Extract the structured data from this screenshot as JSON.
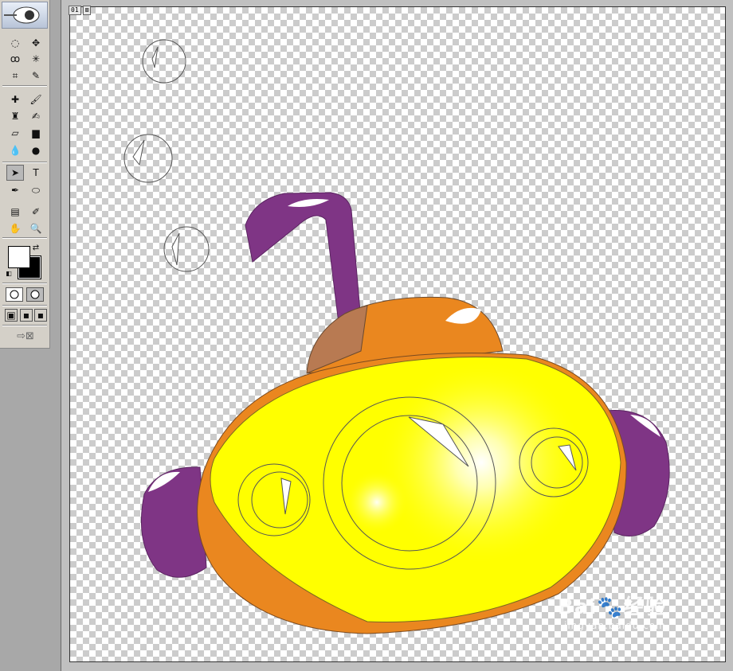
{
  "canvas": {
    "tabs": [
      "01",
      "⊠"
    ],
    "checker_colors": [
      "#ffffff",
      "#cccccc"
    ]
  },
  "toolbox": {
    "tools": [
      {
        "name": "marquee-tool",
        "glyph": "◌"
      },
      {
        "name": "move-tool",
        "glyph": "✥"
      },
      {
        "name": "lasso-tool",
        "glyph": "ꝏ"
      },
      {
        "name": "magic-wand-tool",
        "glyph": "✳"
      },
      {
        "name": "crop-tool",
        "glyph": "⌗"
      },
      {
        "name": "slice-tool",
        "glyph": "✎"
      },
      {
        "name": "healing-brush-tool",
        "glyph": "✚"
      },
      {
        "name": "brush-tool",
        "glyph": "🖌"
      },
      {
        "name": "clone-stamp-tool",
        "glyph": "♜"
      },
      {
        "name": "history-brush-tool",
        "glyph": "✍"
      },
      {
        "name": "eraser-tool",
        "glyph": "▱"
      },
      {
        "name": "gradient-tool",
        "glyph": "▆"
      },
      {
        "name": "blur-tool",
        "glyph": "💧"
      },
      {
        "name": "dodge-tool",
        "glyph": "●"
      },
      {
        "name": "path-selection-tool",
        "glyph": "➤"
      },
      {
        "name": "type-tool",
        "glyph": "T"
      },
      {
        "name": "pen-tool",
        "glyph": "✒"
      },
      {
        "name": "shape-tool",
        "glyph": "⬭"
      },
      {
        "name": "notes-tool",
        "glyph": "▤"
      },
      {
        "name": "eyedropper-tool",
        "glyph": "✐"
      },
      {
        "name": "hand-tool",
        "glyph": "✋"
      },
      {
        "name": "zoom-tool",
        "glyph": "🔍"
      }
    ],
    "foreground_color": "#ffffff",
    "background_color": "#000000"
  },
  "artwork": {
    "colors": {
      "purple": "#7f3585",
      "orange": "#ea871f",
      "tan": "#b87a52",
      "yellow": "#ffff00",
      "highlight": "#ffffff"
    }
  },
  "watermark": {
    "main": "Bai🐾经验",
    "sub": "jingyan.baidu.com"
  }
}
